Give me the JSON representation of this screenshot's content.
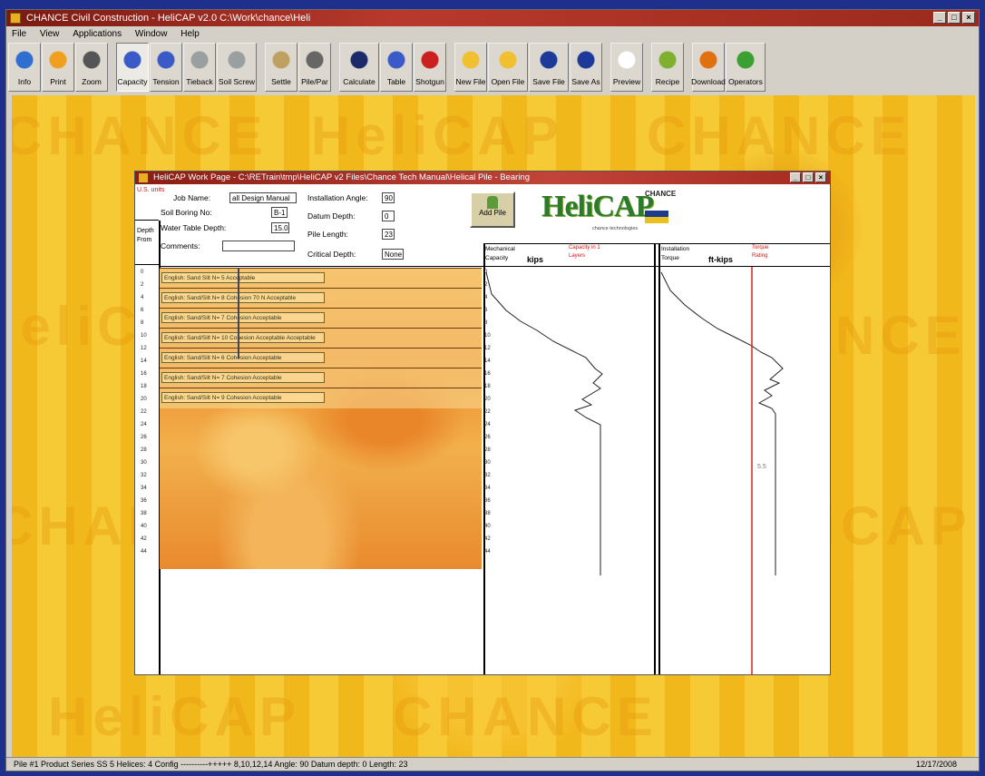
{
  "app": {
    "title": "CHANCE Civil Construction  -  HeliCAP v2.0  C:\\Work\\chance\\Heli",
    "menu": [
      "File",
      "View",
      "Applications",
      "Window",
      "Help"
    ]
  },
  "toolbar": [
    {
      "label": "Info",
      "icon": "eye-icon",
      "color": "#2e6fd1"
    },
    {
      "label": "Print",
      "icon": "printer-icon",
      "color": "#f0a020"
    },
    {
      "label": "Zoom",
      "icon": "zoom-icon",
      "color": "#555555"
    },
    {
      "label": "Capacity",
      "icon": "capacity-icon",
      "color": "#3a5bc7",
      "selected": true
    },
    {
      "label": "Tension",
      "icon": "tension-icon",
      "color": "#3a5bc7"
    },
    {
      "label": "Tieback",
      "icon": "tieback-icon",
      "color": "#9aa0a0"
    },
    {
      "label": "Soil Screw",
      "icon": "soilscrew-icon",
      "color": "#9aa0a0"
    },
    {
      "label": "Settle",
      "icon": "settle-icon",
      "color": "#c0a060"
    },
    {
      "label": "Pile/Par",
      "icon": "pile-icon",
      "color": "#666666"
    },
    {
      "label": "Calculate",
      "icon": "calculator-icon",
      "color": "#1d2a6a"
    },
    {
      "label": "Table",
      "icon": "table-icon",
      "color": "#3a5bc7"
    },
    {
      "label": "Shotgun",
      "icon": "target-icon",
      "color": "#cc2020"
    },
    {
      "label": "New File",
      "icon": "new-folder-icon",
      "color": "#f0c030"
    },
    {
      "label": "Open File",
      "icon": "open-folder-icon",
      "color": "#f0c030"
    },
    {
      "label": "Save File",
      "icon": "save-icon",
      "color": "#1d3a9a"
    },
    {
      "label": "Save As",
      "icon": "save-as-icon",
      "color": "#1d3a9a"
    },
    {
      "label": "Preview",
      "icon": "preview-icon",
      "color": "#ffffff"
    },
    {
      "label": "Recipe",
      "icon": "recipe-icon",
      "color": "#7fb030"
    },
    {
      "label": "Download",
      "icon": "download-icon",
      "color": "#e07010"
    },
    {
      "label": "Operators",
      "icon": "operators-icon",
      "color": "#3aa030"
    }
  ],
  "desktop_watermark": [
    "CHANCE",
    "HeliCAP"
  ],
  "status": {
    "left": "Pile #1   Product Series SS 5   Helices: 4   Config  ----------+++++ 8,10,12,14   Angle: 90   Datum depth: 0   Length: 23",
    "date": "12/17/2008"
  },
  "child": {
    "title": "HeliCAP Work Page  -  C:\\RETrain\\tmp\\HeliCAP v2 Files\\Chance Tech Manual\\Helical Pile   -   Bearing",
    "us_units": "U.S. units",
    "job_name_label": "Job Name:",
    "job_name_value": "all Design Manual",
    "soil_boring_label": "Soil Boring No:",
    "soil_boring_value": "B-1",
    "water_table_label": "Water Table Depth:",
    "water_table_value": "15.0",
    "comments_label": "Comments:",
    "comments_value": "",
    "install_angle_label": "Installation Angle:",
    "install_angle_value": "90",
    "datum_label": "Datum Depth:",
    "datum_value": "0",
    "pile_length_label": "Pile Length:",
    "pile_length_value": "23",
    "critical_depth_label": "Critical Depth:",
    "critical_depth_value": "None",
    "add_pile_label": "Add Pile",
    "depth_label": "Depth",
    "from_label": "From",
    "logo_text": "HeliCAP",
    "logo_sub": "chance technologies",
    "brand": "CHANCE",
    "mech_label_1": "Mechanical",
    "mech_label_2": "Capacity",
    "mech_units": "kips",
    "mech_red_1": "Capacity in 1",
    "mech_red_2": "Layers",
    "inst_label_1": "Installation",
    "inst_label_2": "Torque",
    "inst_units": "ft-kips",
    "inst_red_1": "Torque",
    "inst_red_2": "Rating",
    "rating_value": "5.5",
    "layers": [
      "English: Sand Silt  N=  5  Acceptable",
      "English: Sand/Silt  N=  8  Cohesion  70  N  Acceptable",
      "English: Sand/Silt  N=  7  Cohesion  Acceptable",
      "English: Sand/Silt  N=  10  Cohesion  Acceptable  Acceptable",
      "English: Sand/Silt  N=  6  Cohesion  Acceptable",
      "English: Sand/Silt  N=  7  Cohesion  Acceptable",
      "English: Sand/Silt  N=  9  Cohesion  Acceptable"
    ],
    "depth_ticks": [
      "0",
      "2",
      "4",
      "6",
      "8",
      "10",
      "12",
      "14",
      "16",
      "18",
      "20",
      "22",
      "24",
      "26",
      "28",
      "30",
      "32",
      "34",
      "36",
      "38",
      "40",
      "42",
      "44"
    ]
  },
  "colors": {
    "desktop": "#f2c020",
    "title_bar": "#b8392c",
    "torque_rating_line": "#e02020"
  }
}
